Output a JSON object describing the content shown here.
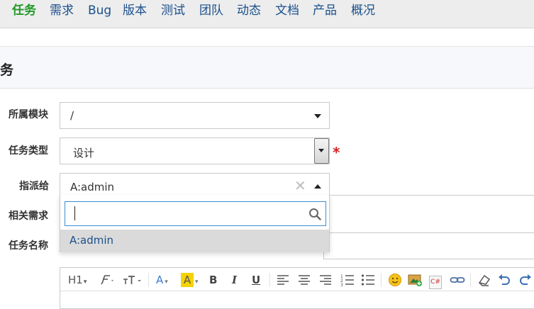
{
  "nav": {
    "items": [
      {
        "label": "任务",
        "active": true
      },
      {
        "label": "需求"
      },
      {
        "label": "Bug"
      },
      {
        "label": "版本"
      },
      {
        "label": "测试"
      },
      {
        "label": "团队"
      },
      {
        "label": "动态"
      },
      {
        "label": "文档"
      },
      {
        "label": "产品"
      },
      {
        "label": "概况"
      }
    ]
  },
  "page": {
    "title": "务"
  },
  "form": {
    "module": {
      "label": "所属模块",
      "value": "/"
    },
    "type": {
      "label": "任务类型",
      "value": "设计",
      "required_mark": "*"
    },
    "assign": {
      "label": "指派给",
      "value": "A:admin",
      "clear_symbol": "✕",
      "search_value": "",
      "options": [
        "A:admin"
      ]
    },
    "story": {
      "label": "相关需求"
    },
    "name": {
      "label": "任务名称",
      "value": ""
    }
  },
  "editor": {
    "toolbar": [
      "heading-h1",
      "font-family",
      "font-size",
      "font-color",
      "highlight",
      "bold",
      "italic",
      "underline",
      "align-left",
      "align-center",
      "align-right",
      "ordered-list",
      "unordered-list",
      "emoticon",
      "image",
      "code",
      "link",
      "clear-format",
      "undo",
      "redo"
    ],
    "labels": {
      "h1": "H1",
      "bold": "B",
      "italic": "I",
      "underline": "U",
      "color": "A",
      "highlight": "A",
      "code": "C#"
    }
  },
  "colors": {
    "accent": "#229a28",
    "link": "#1a4f8b",
    "required": "#d61f1f",
    "focus": "#3c8dd3"
  }
}
